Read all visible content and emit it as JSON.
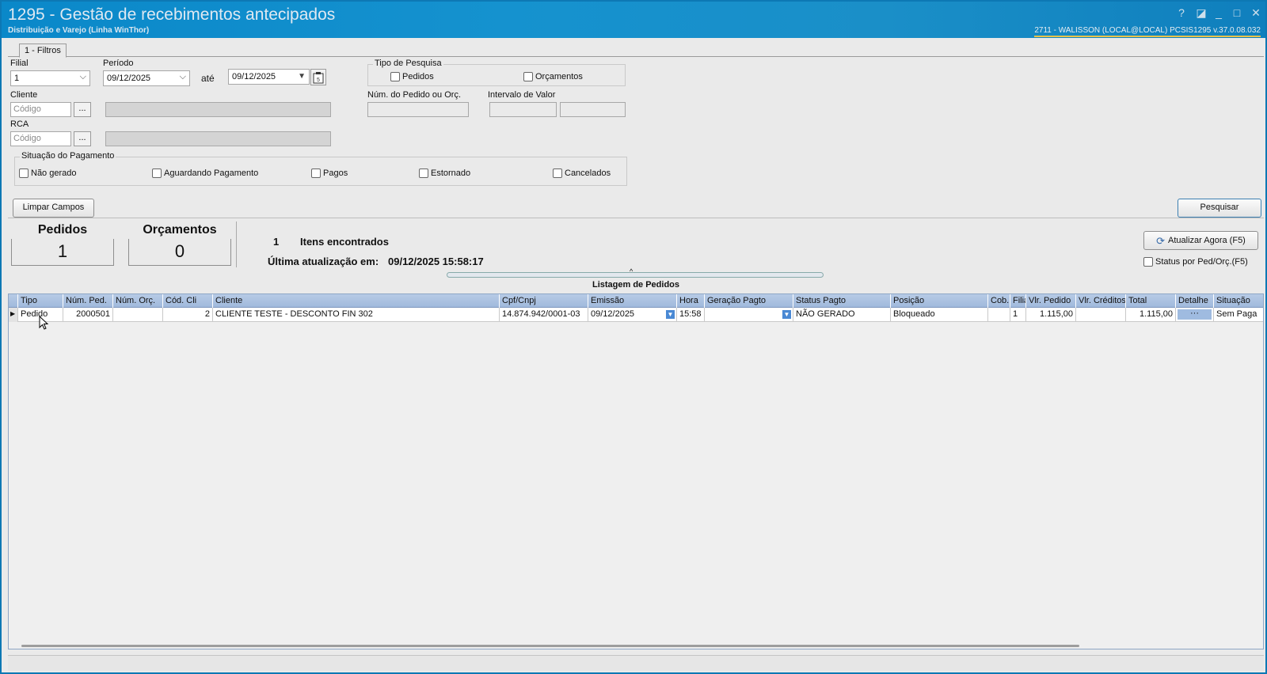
{
  "window": {
    "title": "1295 - Gestão de recebimentos antecipados",
    "subtitle": "Distribuição e Varejo (Linha WinThor)",
    "userinfo": "2711 - WALISSON (LOCAL@LOCAL)   PCSIS1295  v.37.0.08.032",
    "help": "?",
    "restore": "◪",
    "minimize": "_",
    "maximize": "□",
    "close": "✕"
  },
  "tabs": [
    {
      "label": "1 - Filtros"
    }
  ],
  "filters": {
    "filial_label": "Filial",
    "filial_value": "1",
    "periodo_label": "Período",
    "periodo_start": "09/12/2025",
    "ate_label": "até",
    "periodo_end": "09/12/2025",
    "cliente_label": "Cliente",
    "codigo_placeholder": "Código",
    "dots": "...",
    "rca_label": "RCA",
    "tipo_pesquisa_label": "Tipo de Pesquisa",
    "pedidos": "Pedidos",
    "orcamentos": "Orçamentos",
    "num_pedido_label": "Núm. do Pedido ou Orç.",
    "intervalo_label": "Intervalo de Valor",
    "situacao_label": "Situação do Pagamento",
    "situacoes": [
      "Não gerado",
      "Aguardando Pagamento",
      "Pagos",
      "Estornado",
      "Cancelados"
    ],
    "limpar": "Limpar Campos",
    "pesquisar": "Pesquisar"
  },
  "summary": {
    "pedidos_label": "Pedidos",
    "pedidos_count": "1",
    "orcamentos_label": "Orçamentos",
    "orcamentos_count": "0",
    "itens_count": "1",
    "itens_label": "Itens encontrados",
    "atualizacao_label": "Última atualização em:",
    "atualizacao_value": "09/12/2025 15:58:17",
    "atualizar_button": "Atualizar Agora (F5)",
    "status_check": "Status por Ped/Orç.(F5)"
  },
  "grid": {
    "title": "Listagem de Pedidos",
    "columns": [
      "Tipo",
      "Núm. Ped.",
      "Núm. Orç.",
      "Cód. Cli",
      "Cliente",
      "Cpf/Cnpj",
      "Emissão",
      "Hora",
      "Geração Pagto",
      "Status Pagto",
      "Posição",
      "Cob.",
      "Filia",
      "Vlr. Pedido",
      "Vlr. Créditos",
      "Total",
      "Detalhe",
      "Situação"
    ],
    "rows": [
      {
        "tipo": "Pedido",
        "num_ped": "2000501",
        "num_orc": "",
        "cod_cli": "2",
        "cliente": "CLIENTE TESTE - DESCONTO FIN 302",
        "cpf": "14.874.942/0001-03",
        "emissao": "09/12/2025",
        "hora": "15:58",
        "geracao": "",
        "status": "NÃO GERADO",
        "posicao": "Bloqueado",
        "cob": "",
        "filial": "1",
        "vlr_pedido": "1.115,00",
        "vlr_creditos": "",
        "total": "1.115,00",
        "detalhe": "···",
        "situacao": "Sem Paga"
      }
    ]
  }
}
